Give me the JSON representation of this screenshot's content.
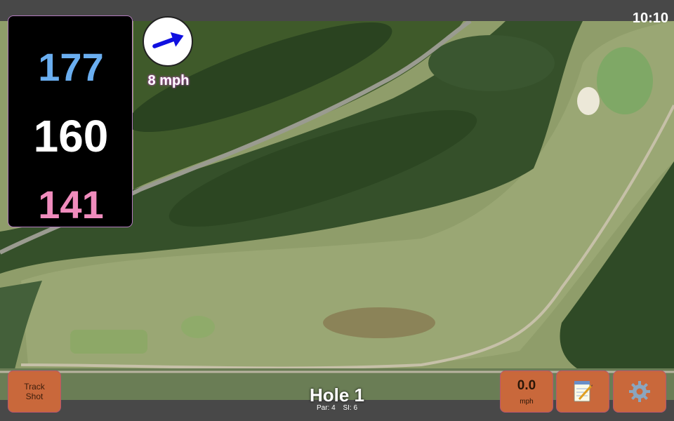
{
  "status": {
    "time": "10:10"
  },
  "distances": {
    "back": "177",
    "center": "160",
    "front": "141"
  },
  "wind": {
    "speed_label": "8 mph",
    "icon": "wind-arrow-icon",
    "direction_deg": -20
  },
  "hole": {
    "title": "Hole 1",
    "par": "Par: 4",
    "si": "SI: 6"
  },
  "buttons": {
    "track_line1": "Track",
    "track_line2": "Shot",
    "speed_value": "0.0",
    "speed_unit": "mph",
    "notes_icon": "notepad-icon",
    "settings_icon": "gear-icon"
  },
  "colors": {
    "back": "#6aaef0",
    "center": "#ffffff",
    "front": "#f08cbd",
    "button": "#c9683b",
    "panel_border": "#b37bbf"
  }
}
